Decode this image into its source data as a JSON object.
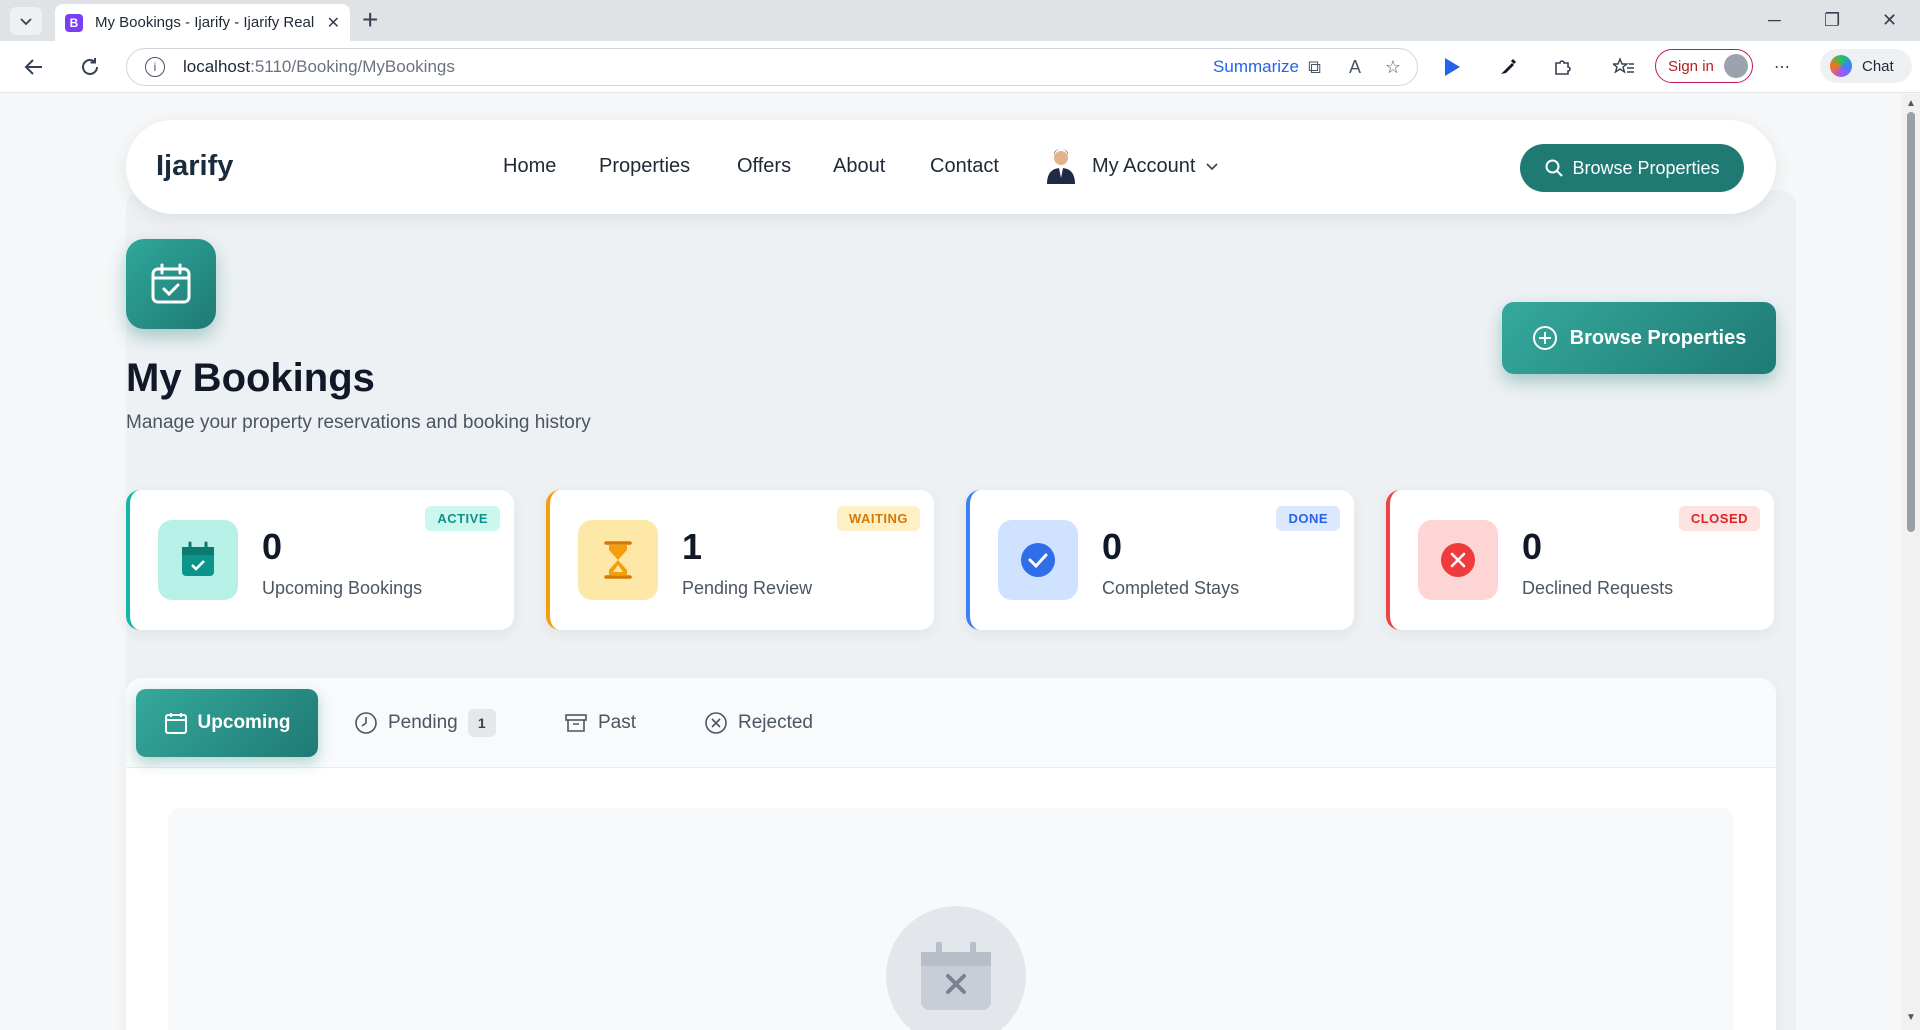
{
  "browser": {
    "tab_title": "My Bookings - Ijarify - Ijarify Real",
    "tab_favicon": "B",
    "url_host": "localhost",
    "url_path": ":5110/Booking/MyBookings",
    "summarize": "Summarize",
    "sign_in": "Sign in",
    "chat": "Chat"
  },
  "navbar": {
    "brand": "Ijarify",
    "links": [
      "Home",
      "Properties",
      "Offers",
      "About",
      "Contact"
    ],
    "account": "My Account",
    "browse_button": "Browse Properties"
  },
  "header": {
    "title": "My Bookings",
    "subtitle": "Manage your property reservations and booking history",
    "browse_button": "Browse Properties"
  },
  "stats": [
    {
      "value": "0",
      "label": "Upcoming Bookings",
      "badge": "ACTIVE"
    },
    {
      "value": "1",
      "label": "Pending Review",
      "badge": "WAITING"
    },
    {
      "value": "0",
      "label": "Completed Stays",
      "badge": "DONE"
    },
    {
      "value": "0",
      "label": "Declined Requests",
      "badge": "CLOSED"
    }
  ],
  "tabs": {
    "upcoming": "Upcoming",
    "pending": "Pending",
    "pending_count": "1",
    "past": "Past",
    "rejected": "Rejected"
  },
  "colors": {
    "brand": "#1f7a74",
    "active": "#14b8a6",
    "waiting": "#f59e0b",
    "done": "#3b82f6",
    "closed": "#ef4444"
  }
}
